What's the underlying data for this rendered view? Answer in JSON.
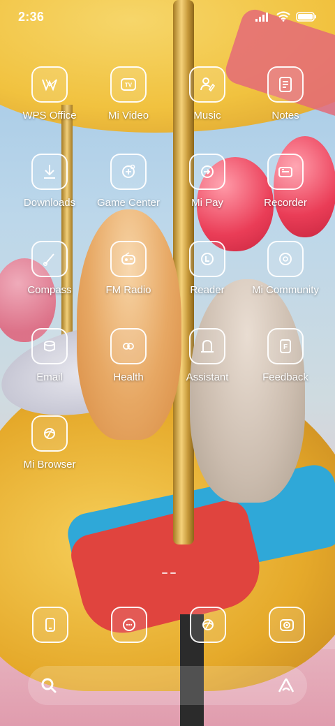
{
  "status_bar": {
    "time": "2:36"
  },
  "apps": [
    {
      "label": "WPS Office",
      "icon": "wps-icon"
    },
    {
      "label": "Mi Video",
      "icon": "tv-icon"
    },
    {
      "label": "Music",
      "icon": "music-icon"
    },
    {
      "label": "Notes",
      "icon": "notes-icon"
    },
    {
      "label": "Downloads",
      "icon": "download-icon"
    },
    {
      "label": "Game Center",
      "icon": "game-icon"
    },
    {
      "label": "Mi Pay",
      "icon": "pay-icon"
    },
    {
      "label": "Recorder",
      "icon": "recorder-icon"
    },
    {
      "label": "Compass",
      "icon": "compass-icon"
    },
    {
      "label": "FM Radio",
      "icon": "radio-icon"
    },
    {
      "label": "Reader",
      "icon": "reader-icon"
    },
    {
      "label": "Mi Community",
      "icon": "community-icon"
    },
    {
      "label": "Email",
      "icon": "email-icon"
    },
    {
      "label": "Health",
      "icon": "health-icon"
    },
    {
      "label": "Assistant",
      "icon": "assistant-icon"
    },
    {
      "label": "Feedback",
      "icon": "feedback-icon"
    },
    {
      "label": "Mi Browser",
      "icon": "browser-icon"
    }
  ],
  "dock": [
    {
      "icon": "phone-icon"
    },
    {
      "icon": "messages-icon"
    },
    {
      "icon": "browser-icon"
    },
    {
      "icon": "camera-icon"
    }
  ],
  "feedback_tile_letter": "F",
  "colors": {
    "tile_border": "#ffffff",
    "wallpaper_balloon": "#ea3d57",
    "wallpaper_canopy": "#f1c23f"
  }
}
